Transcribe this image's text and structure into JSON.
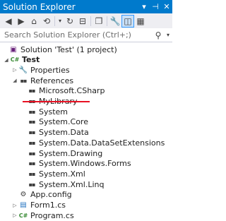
{
  "window": {
    "title": "Solution Explorer",
    "pin_glyph": "▾",
    "autohide_glyph": "⊣",
    "close_glyph": "✕"
  },
  "toolbar": {
    "buttons": [
      {
        "name": "back-icon",
        "glyph": "◀"
      },
      {
        "name": "forward-icon",
        "glyph": "▶"
      },
      {
        "name": "home-icon",
        "glyph": "⌂"
      },
      {
        "name": "sync-icon",
        "glyph": "⟲"
      },
      {
        "name": "sync-dropdown-icon",
        "glyph": "▾"
      },
      {
        "name": "refresh-icon",
        "glyph": "↻"
      },
      {
        "name": "collapse-all-icon",
        "glyph": "⊟"
      },
      {
        "name": "copy-icon",
        "glyph": "❐"
      },
      {
        "name": "properties-icon",
        "glyph": "🔧"
      },
      {
        "name": "preview-icon",
        "glyph": "◫"
      },
      {
        "name": "show-all-files-icon",
        "glyph": "▦"
      }
    ]
  },
  "search": {
    "placeholder": "Search Solution Explorer (Ctrl+;)",
    "icon": "⚲",
    "dropdown": "▾"
  },
  "tree": [
    {
      "label": "Solution 'Test' (1 project)",
      "icon": "solution-icon",
      "glyph": "▣",
      "color": "#68217a",
      "arrow": "",
      "indent": 0
    },
    {
      "label": "Test",
      "icon": "csharp-project-icon",
      "glyph": "C#",
      "color": "#388a34",
      "arrow": "◢",
      "indent": 1,
      "bold": true
    },
    {
      "label": "Properties",
      "icon": "properties-folder-icon",
      "glyph": "🔧",
      "color": "#424242",
      "arrow": "▷",
      "indent": 2
    },
    {
      "label": "References",
      "icon": "references-icon",
      "glyph": "▪▪",
      "color": "#424242",
      "arrow": "◢",
      "indent": 2
    },
    {
      "label": "Microsoft.CSharp",
      "icon": "reference-icon",
      "glyph": "▪▪",
      "color": "#3d3d3d",
      "arrow": "",
      "indent": 3
    },
    {
      "label": "MyLibrary",
      "icon": "reference-icon",
      "glyph": "▪▪",
      "color": "#3d3d3d",
      "arrow": "",
      "indent": 3
    },
    {
      "label": "System",
      "icon": "reference-icon",
      "glyph": "▪▪",
      "color": "#3d3d3d",
      "arrow": "",
      "indent": 3
    },
    {
      "label": "System.Core",
      "icon": "reference-icon",
      "glyph": "▪▪",
      "color": "#3d3d3d",
      "arrow": "",
      "indent": 3
    },
    {
      "label": "System.Data",
      "icon": "reference-icon",
      "glyph": "▪▪",
      "color": "#3d3d3d",
      "arrow": "",
      "indent": 3
    },
    {
      "label": "System.Data.DataSetExtensions",
      "icon": "reference-icon",
      "glyph": "▪▪",
      "color": "#3d3d3d",
      "arrow": "",
      "indent": 3
    },
    {
      "label": "System.Drawing",
      "icon": "reference-icon",
      "glyph": "▪▪",
      "color": "#3d3d3d",
      "arrow": "",
      "indent": 3
    },
    {
      "label": "System.Windows.Forms",
      "icon": "reference-icon",
      "glyph": "▪▪",
      "color": "#3d3d3d",
      "arrow": "",
      "indent": 3
    },
    {
      "label": "System.Xml",
      "icon": "reference-icon",
      "glyph": "▪▪",
      "color": "#3d3d3d",
      "arrow": "",
      "indent": 3
    },
    {
      "label": "System.Xml.Linq",
      "icon": "reference-icon",
      "glyph": "▪▪",
      "color": "#3d3d3d",
      "arrow": "",
      "indent": 3
    },
    {
      "label": "App.config",
      "icon": "config-file-icon",
      "glyph": "⚙",
      "color": "#424242",
      "arrow": "",
      "indent": 2
    },
    {
      "label": "Form1.cs",
      "icon": "form-file-icon",
      "glyph": "▤",
      "color": "#1e6fbf",
      "arrow": "▷",
      "indent": 2
    },
    {
      "label": "Program.cs",
      "icon": "csharp-file-icon",
      "glyph": "C#",
      "color": "#388a34",
      "arrow": "▷",
      "indent": 2
    }
  ],
  "colors": {
    "title_bar": "#007acc",
    "toolbar": "#eeeef2",
    "highlight_underline": "#e81123"
  }
}
